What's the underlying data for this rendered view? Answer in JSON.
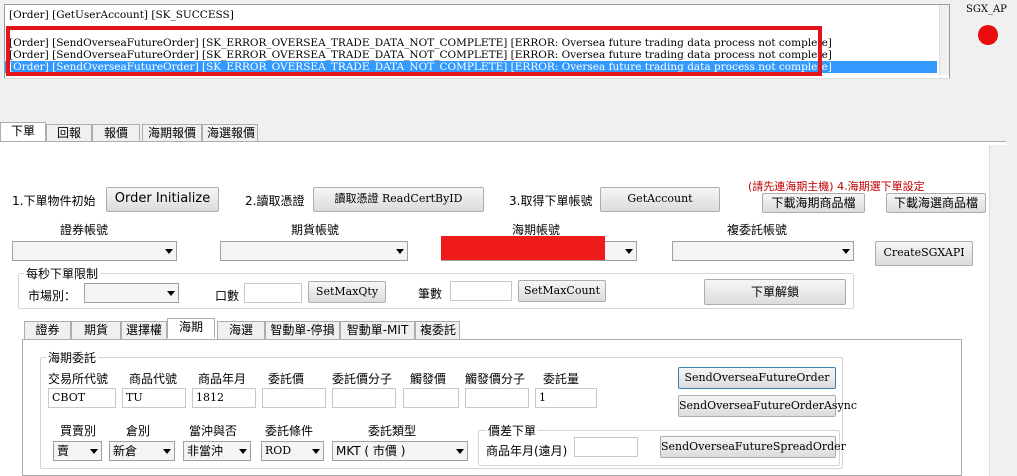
{
  "log": {
    "lines": [
      "[Order] [GetUserAccount] [SK_SUCCESS]",
      "[Order] [SendOverseaFutureOrder] [SK_ERROR_OVERSEA_TRADE_DATA_NOT_COMPLETE] [ERROR: Oversea future trading data process not complete]",
      "[Order] [SendOverseaFutureOrder] [SK_ERROR_OVERSEA_TRADE_DATA_NOT_COMPLETE] [ERROR: Oversea future trading data process not complete]",
      "[Order] [SendOverseaFutureOrder] [SK_ERROR_OVERSEA_TRADE_DATA_NOT_COMPLETE] [ERROR: Oversea future trading data process not complete]"
    ]
  },
  "sgx_label": "SGX_AP",
  "colors": {
    "status_light": "#e80c0c",
    "highlight_box": "#e4141b",
    "selection": "#3399ff",
    "note_text": "#c00000"
  },
  "main_tabs": [
    "下單",
    "回報",
    "報價",
    "海期報價",
    "海選報價"
  ],
  "step1": {
    "label": "1.下單物件初始",
    "button": "Order Initialize"
  },
  "step2": {
    "label": "2.讀取憑證",
    "button": "讀取憑證 ReadCertByID"
  },
  "step3": {
    "label": "3.取得下單帳號",
    "button": "GetAccount"
  },
  "step4": {
    "note": "(請先連海期主機) 4.海期選下單設定",
    "btn_futures": "下載海期商品檔",
    "btn_options": "下載海選商品檔"
  },
  "accounts": {
    "securities": "證券帳號",
    "futures": "期貨帳號",
    "oversea": "海期帳號",
    "delegate": "複委託帳號",
    "create_btn": "CreateSGXAPI"
  },
  "limits": {
    "title": "每秒下單限制",
    "market": "市場別：",
    "qty_label": "口數",
    "qty_btn": "SetMaxQty",
    "count_label": "筆數",
    "count_btn": "SetMaxCount",
    "unlock_btn": "下單解鎖"
  },
  "sub_tabs": [
    "證券",
    "期貨",
    "選擇權",
    "海期",
    "海選",
    "智動單-停損",
    "智動單-MIT",
    "複委託"
  ],
  "oversea_order": {
    "title": "海期委託",
    "exchange_label": "交易所代號",
    "exchange_value": "CBOT",
    "product_label": "商品代號",
    "product_value": "TU",
    "month_label": "商品年月",
    "month_value": "1812",
    "price_label": "委託價",
    "price_value": "",
    "price_num_label": "委託價分子",
    "price_num_value": "",
    "trigger_label": "觸發價",
    "trigger_value": "",
    "trigger_num_label": "觸發價分子",
    "trigger_num_value": "",
    "qty_label": "委託量",
    "qty_value": "1",
    "buysell_label": "買賣別",
    "buysell_value": "賣",
    "position_label": "倉別",
    "position_value": "新倉",
    "daytrade_label": "當沖與否",
    "daytrade_value": "非當沖",
    "condition_label": "委託條件",
    "condition_value": "ROD",
    "type_label": "委託類型",
    "type_value": "MKT ( 市價 )",
    "spread_title": "價差下單",
    "far_month_label": "商品年月(遠月)",
    "far_month_value": "",
    "btn_send": "SendOverseaFutureOrder",
    "btn_send_async": "SendOverseaFutureOrderAsync",
    "btn_spread": "SendOverseaFutureSpreadOrder"
  }
}
